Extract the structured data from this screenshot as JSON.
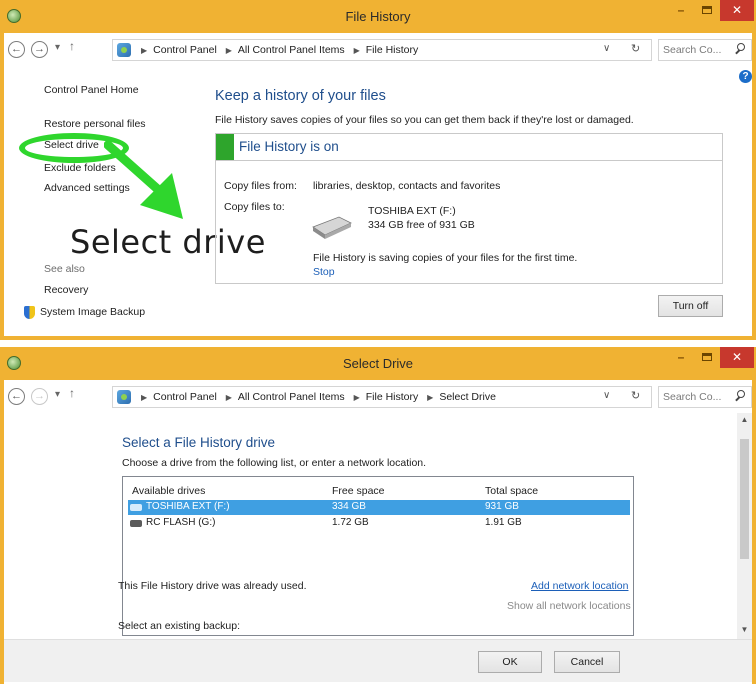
{
  "colors": {
    "frame": "#f0b233",
    "link": "#1c5fb8",
    "heading": "#1f4e8c",
    "status_bar": "#2ea52c",
    "highlight_oval": "#2fd62d",
    "selected_row": "#3f9fe2",
    "close_button": "#c7382d"
  },
  "window1": {
    "title": "File History",
    "breadcrumb": [
      "Control Panel",
      "All Control Panel Items",
      "File History"
    ],
    "search_placeholder": "Search Co...",
    "sidebar": {
      "home": "Control Panel Home",
      "items": [
        "Restore personal files",
        "Select drive",
        "Exclude folders",
        "Advanced settings"
      ],
      "see_also": "See also",
      "recovery": "Recovery",
      "system_image_backup": "System Image Backup"
    },
    "callout": "Select drive",
    "heading": "Keep a history of your files",
    "description": "File History saves copies of your files so you can get them back if they're lost or damaged.",
    "status": "File History is on",
    "copy_from_label": "Copy files from:",
    "copy_from_value": "libraries, desktop, contacts and favorites",
    "copy_to_label": "Copy files to:",
    "drive_name": "TOSHIBA EXT (F:)",
    "drive_space": "334 GB free of 931 GB",
    "saving_message": "File History is saving copies of your files for the first time.",
    "stop_link": "Stop",
    "turn_off_button": "Turn off"
  },
  "window2": {
    "title": "Select Drive",
    "breadcrumb": [
      "Control Panel",
      "All Control Panel Items",
      "File History",
      "Select Drive"
    ],
    "search_placeholder": "Search Co...",
    "heading": "Select a File History drive",
    "description": "Choose a drive from the following list, or enter a network location.",
    "columns": [
      "Available drives",
      "Free space",
      "Total space"
    ],
    "drives": [
      {
        "name": "TOSHIBA EXT (F:)",
        "free": "334 GB",
        "total": "931 GB",
        "selected": true
      },
      {
        "name": "RC FLASH (G:)",
        "free": "1.72 GB",
        "total": "1.91 GB",
        "selected": false
      }
    ],
    "already_used_note": "This File History drive was already used.",
    "add_network_location": "Add network location",
    "show_all_network_locations": "Show all network locations",
    "select_existing_backup": "Select an existing backup:",
    "ok_button": "OK",
    "cancel_button": "Cancel"
  },
  "icons": {
    "back": "back-arrow-icon",
    "forward": "forward-arrow-icon",
    "up": "up-arrow-icon",
    "refresh": "refresh-icon",
    "search": "search-icon",
    "help": "help-icon",
    "drive": "hard-drive-icon",
    "shield": "uac-shield-icon"
  }
}
